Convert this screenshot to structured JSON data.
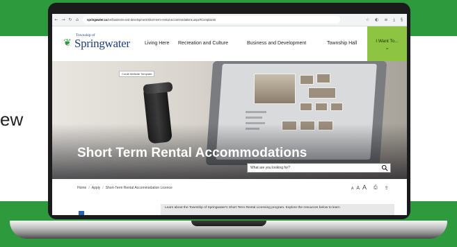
{
  "page": {
    "side_text": "ew"
  },
  "browser": {
    "url_domain": "springwater.ca",
    "url_path": "/en/business-and-development/short-term-rental-accommodations.aspx#Complaints",
    "icons": [
      "star-icon",
      "extensions-icon",
      "menu-icon",
      "download-icon",
      "profile-icon"
    ]
  },
  "site": {
    "logo_small": "Township of",
    "logo_big": "Springwater",
    "nav": [
      "Living Here",
      "Recreation and Culture",
      "Business and Development",
      "Township Hall"
    ],
    "iwant": "I Want To..."
  },
  "hero": {
    "credit": "Credit Website Template",
    "title": "Short Term Rental Accommodations",
    "search_placeholder": "What are you looking for?"
  },
  "breadcrumb": [
    "Home",
    "Apply",
    "Short-Term Rental Accommodation Licence"
  ],
  "tools": {
    "a_small": "A",
    "a_medium": "A",
    "a_large": "A"
  },
  "intro": "Learn about the Township of Springwater's Short Term Rental Licensing program. Explore the resources below to learn",
  "colors": {
    "brand_green": "#2e9a3e",
    "accent_lime": "#8dc441",
    "logo_blue": "#1d3f7a"
  }
}
